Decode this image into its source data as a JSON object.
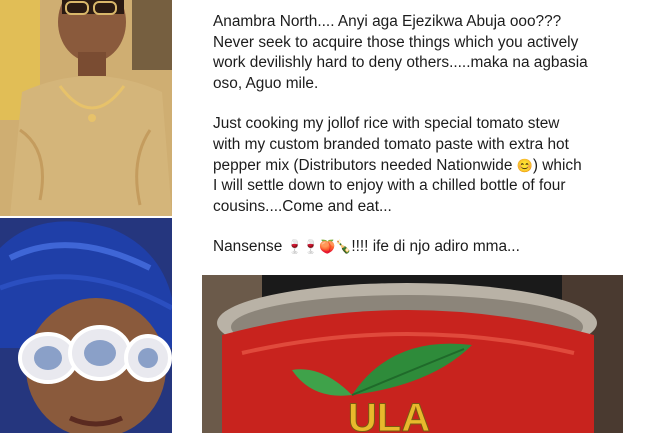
{
  "post": {
    "paragraph_1": "Anambra North.... Anyi aga Ejezikwa Abuja ooo???\nNever seek to acquire those things which you actively\nwork devilishly hard to deny others.....maka na agbasia\noso, Aguo mile.",
    "paragraph_2_before_emoji": "Just cooking my jollof rice with special tomato stew\nwith my custom branded tomato paste with extra hot\npepper mix (Distributors needed Nationwide ",
    "paragraph_2_emoji": "😊",
    "paragraph_2_after_emoji": ") which\nI will settle down to enjoy with a chilled bottle of four\ncousins....Come and eat...",
    "paragraph_3_start": "Nansense ",
    "paragraph_3_emojis": "🍷🍷🍑🍾",
    "paragraph_3_end": "!!!! ife di njo adiro mma..."
  },
  "can_label": {
    "brand_text": "ULA"
  },
  "colors": {
    "text": "#1c1c1c",
    "can_red": "#c8231e",
    "leaf_green": "#2e8b3a",
    "brand_yellow": "#e8b92c"
  }
}
